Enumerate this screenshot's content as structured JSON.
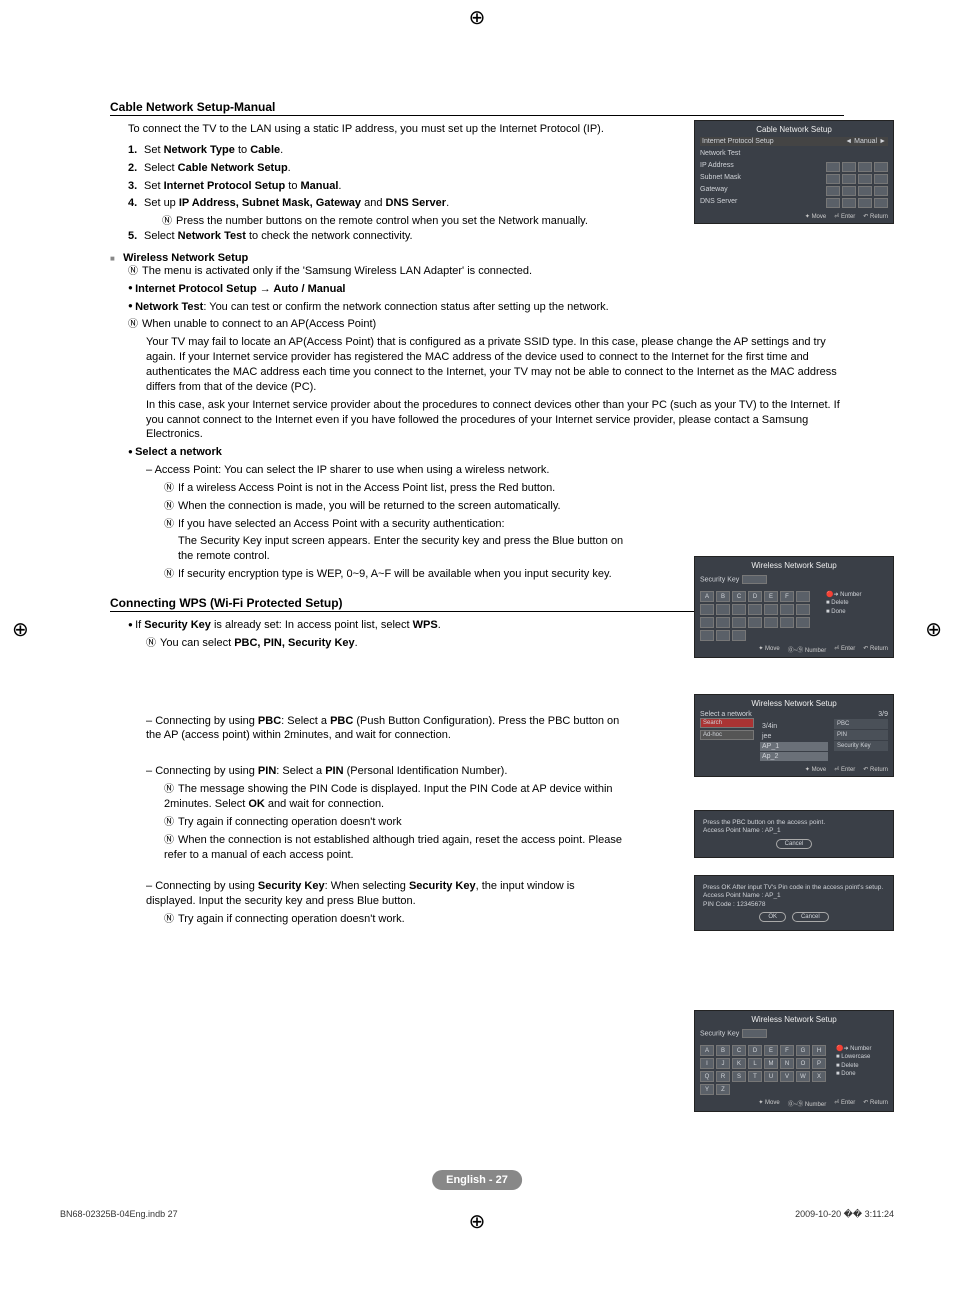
{
  "page": {
    "section1_title": "Cable Network Setup-Manual",
    "intro": "To connect the TV to the LAN using a static IP address, you must set up the Internet Protocol (IP).",
    "steps": [
      {
        "num": "1.",
        "pre": "Set ",
        "b1": "Network Type",
        "mid": " to ",
        "b2": "Cable",
        "post": "."
      },
      {
        "num": "2.",
        "pre": "Select ",
        "b1": "Cable Network Setup",
        "mid": "",
        "b2": "",
        "post": "."
      },
      {
        "num": "3.",
        "pre": "Set ",
        "b1": "Internet Protocol Setup",
        "mid": " to ",
        "b2": "Manual",
        "post": "."
      },
      {
        "num": "4.",
        "pre": "Set up ",
        "b1": "IP Address, Subnet Mask, Gateway",
        "mid": " and ",
        "b2": "DNS Server",
        "post": "."
      },
      {
        "num": "5.",
        "pre": "Select ",
        "b1": "Network Test",
        "mid": " to check the network connectivity.",
        "b2": "",
        "post": ""
      }
    ],
    "step4_note": "Press the number buttons on the remote control when you set the Network manually.",
    "wireless_heading": "Wireless Network Setup",
    "wireless_note1": "The menu is activated only if the 'Samsung Wireless LAN Adapter' is connected.",
    "wireless_bullet1_b": "Internet Protocol Setup → Auto / Manual",
    "wireless_bullet2_b": "Network Test",
    "wireless_bullet2_t": ": You can test or confirm the network connection status after setting up the network.",
    "wireless_note2": "When unable to connect to an AP(Access Point)",
    "wireless_para1": "Your TV may fail to locate an AP(Access Point) that is configured as a private SSID type. In this case, please change the AP settings and try again. If your Internet service provider has registered the MAC address of the device used to connect to the Internet for the first time and authenticates the MAC address each time you connect to the Internet, your TV may not be able to connect to the Internet as the MAC address differs from that of the device (PC).",
    "wireless_para2": "In this case, ask your Internet service provider about the procedures to connect devices other than your PC (such as your TV) to the Internet. If you cannot connect to the Internet even if you have followed the procedures of your Internet service provider, please contact a Samsung Electronics.",
    "select_network_b": "Select a network",
    "select_network_dash": "Access Point: You can select the IP sharer to use when using a wireless network.",
    "sn_note1": "If a wireless Access Point is not in the Access Point list, press the Red button.",
    "sn_note2": "When the connection is made, you will be returned to the screen automatically.",
    "sn_note3": "If you have selected an Access Point with a security authentication:",
    "sn_note3_sub": "The Security Key input screen appears. Enter the security key and press the Blue button on the remote control.",
    "sn_note4": "If security encryption type is WEP, 0~9, A~F will be available when you input security key.",
    "wps_heading": "Connecting WPS (Wi-Fi Protected Setup)",
    "wps_bullet_pre": "If ",
    "wps_bullet_b": "Security Key",
    "wps_bullet_mid": " is already set: In access point list, select ",
    "wps_bullet_b2": "WPS",
    "wps_bullet_post": ".",
    "wps_note1_pre": "You can select ",
    "wps_note1_b": "PBC, PIN, Security Key",
    "wps_note1_post": ".",
    "pbc_dash_pre": "Connecting by using ",
    "pbc_dash_b1": "PBC",
    "pbc_dash_mid": ": Select a ",
    "pbc_dash_b2": "PBC",
    "pbc_dash_post": " (Push Button Configuration). Press the PBC button on the AP (access point) within 2minutes, and wait for connection.",
    "pin_dash_pre": "Connecting by using ",
    "pin_dash_b1": "PIN",
    "pin_dash_mid": ": Select a ",
    "pin_dash_b2": "PIN",
    "pin_dash_post": " (Personal Identification Number).",
    "pin_note1_pre": "The message showing the PIN Code is displayed. Input the PIN Code at AP device within 2minutes. Select ",
    "pin_note1_b": "OK",
    "pin_note1_post": " and wait for connection.",
    "pin_note2": "Try again if connecting operation doesn't work",
    "pin_note3": "When the connection is not established although tried again, reset the access point. Please refer to a manual of each access point.",
    "sk_dash_pre": "Connecting by using ",
    "sk_dash_b1": "Security Key",
    "sk_dash_mid": ": When selecting ",
    "sk_dash_b2": "Security Key",
    "sk_dash_post": ", the input window is displayed. Input the security key and press Blue button.",
    "sk_note1": "Try again if connecting operation doesn't work.",
    "footer_page": "English - 27",
    "bottom_left": "BN68-02325B-04Eng.indb   27",
    "bottom_right": "2009-10-20   �� 3:11:24"
  },
  "ss1": {
    "title": "Cable Network Setup",
    "row1_l": "Internet Protocol Setup",
    "row1_r": "Manual",
    "row2": "Network Test",
    "fields": [
      "IP Address",
      "Subnet Mask",
      "Gateway",
      "DNS Server"
    ],
    "footer": [
      "Move",
      "Enter",
      "Return"
    ]
  },
  "ss2": {
    "title": "Wireless Network Setup",
    "label": "Security Key",
    "keys": [
      "A",
      "B",
      "C",
      "D",
      "E",
      "F"
    ],
    "side": [
      "Number",
      "Delete",
      "Done"
    ],
    "footer": [
      "Move",
      "Number",
      "Enter",
      "Return"
    ]
  },
  "ss3": {
    "title": "Wireless Network Setup",
    "label": "Select a network",
    "page": "3/9",
    "items": [
      "3/4in",
      "jee",
      "AP_1",
      "Ap_2"
    ],
    "side_red": "Search",
    "side_w": "Ad-hoc",
    "pop": [
      "PBC",
      "PIN",
      "Security Key"
    ],
    "footer": [
      "Move",
      "Enter",
      "Return"
    ]
  },
  "ss4": {
    "line1": "Press the PBC button on the access point.",
    "line2": "Access Point Name : AP_1",
    "btn": "Cancel"
  },
  "ss5": {
    "line1": "Press OK After input TV's Pin code in the access point's setup.",
    "line2": "Access Point Name : AP_1",
    "line3": "PIN Code : 12345678",
    "btn1": "OK",
    "btn2": "Cancel"
  },
  "ss6": {
    "title": "Wireless Network Setup",
    "label": "Security Key",
    "keys": [
      "A",
      "B",
      "C",
      "D",
      "E",
      "F",
      "G",
      "H",
      "I",
      "J",
      "K",
      "L",
      "M",
      "N",
      "O",
      "P",
      "Q",
      "R",
      "S",
      "T",
      "U",
      "V",
      "W",
      "X",
      "Y",
      "Z"
    ],
    "side": [
      "Number",
      "Lowercase",
      "Delete",
      "Done"
    ],
    "footer": [
      "Move",
      "Number",
      "Enter",
      "Return"
    ]
  }
}
